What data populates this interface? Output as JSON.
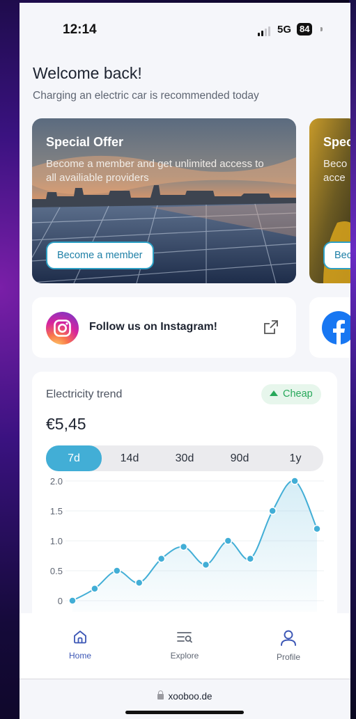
{
  "status_bar": {
    "time": "12:14",
    "network": "5G",
    "battery": "84"
  },
  "header": {
    "title": "Welcome back!",
    "subtitle": "Charging an electric car is recommended today"
  },
  "offers": [
    {
      "title": "Special Offer",
      "text": "Become a member and get unlimited access to all availiable providers",
      "button": "Become a member"
    },
    {
      "title": "Spec",
      "text": "Beco acce",
      "button": "Bec"
    }
  ],
  "social": [
    {
      "label": "Follow us on Instagram!",
      "icon": "instagram-icon"
    },
    {
      "label": "",
      "icon": "facebook-icon"
    }
  ],
  "trend": {
    "label": "Electricity trend",
    "badge": "Cheap",
    "price": "€5,45",
    "ranges": [
      "7d",
      "14d",
      "30d",
      "90d",
      "1y"
    ],
    "active_range": "7d"
  },
  "chart_data": {
    "type": "line",
    "y_ticks": [
      "2.0",
      "1.5",
      "1.0",
      "0.5",
      "0"
    ],
    "ylim": [
      0,
      2.0
    ],
    "values": [
      0,
      0.2,
      0.5,
      0.3,
      0.7,
      0.9,
      0.6,
      1.0,
      0.7,
      1.5,
      2.0,
      1.2
    ],
    "color": "#42aed6"
  },
  "tabs": [
    {
      "label": "Home",
      "icon": "home-icon",
      "active": true
    },
    {
      "label": "Explore",
      "icon": "explore-icon",
      "active": false
    },
    {
      "label": "Profile",
      "icon": "profile-icon",
      "active": false
    }
  ],
  "browser": {
    "url": "xooboo.de"
  }
}
